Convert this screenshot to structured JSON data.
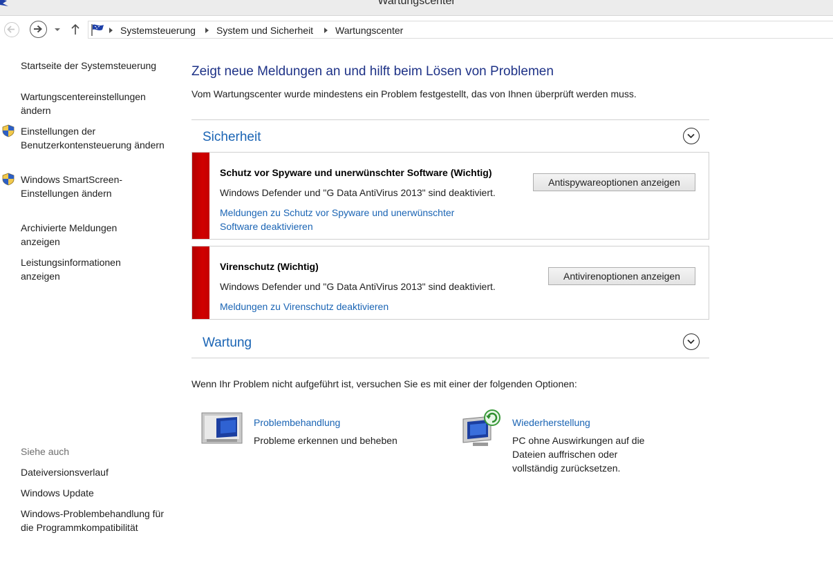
{
  "window": {
    "title": "Wartungscenter"
  },
  "breadcrumb": [
    "Systemsteuerung",
    "System und Sicherheit",
    "Wartungscenter"
  ],
  "sidebar": {
    "items": [
      {
        "label": "Startseite der Systemsteuerung",
        "shield": false
      },
      {
        "label": "Wartungscentereinstellungen ändern",
        "shield": false
      },
      {
        "label": "Einstellungen der Benutzerkontensteuerung ändern",
        "shield": true
      },
      {
        "label": "Windows SmartScreen-Einstellungen ändern",
        "shield": true
      },
      {
        "label": "Archivierte Meldungen anzeigen",
        "shield": false
      },
      {
        "label": "Leistungsinformationen anzeigen",
        "shield": false
      }
    ],
    "see_also_label": "Siehe auch",
    "see_also": [
      {
        "label": "Dateiversionsverlauf"
      },
      {
        "label": "Windows Update"
      },
      {
        "label": "Windows-Problembehandlung für die Programmkompatibilität"
      }
    ]
  },
  "main": {
    "heading": "Zeigt neue Meldungen an und hilft beim Lösen von Problemen",
    "subheading": "Vom Wartungscenter wurde mindestens ein Problem festgestellt, das von Ihnen überprüft werden muss.",
    "security": {
      "title": "Sicherheit",
      "messages": [
        {
          "title": "Schutz vor Spyware und unerwünschter Software  (Wichtig)",
          "text": "Windows Defender und \"G Data AntiVirus 2013\" sind deaktiviert.",
          "link": "Meldungen zu Schutz vor Spyware und unerwünschter Software deaktivieren",
          "button": "Antispywareoptionen anzeigen",
          "status_color": "#cc0000"
        },
        {
          "title": "Virenschutz  (Wichtig)",
          "text": "Windows Defender und \"G Data AntiVirus 2013\" sind deaktiviert.",
          "link": "Meldungen zu Virenschutz deaktivieren",
          "button": "Antivirenoptionen anzeigen",
          "status_color": "#cc0000"
        }
      ]
    },
    "maintenance": {
      "title": "Wartung"
    },
    "hint": "Wenn Ihr Problem nicht aufgeführt ist, versuchen Sie es mit einer der folgenden Optionen:",
    "options": [
      {
        "title": "Problembehandlung",
        "desc": "Probleme erkennen und beheben",
        "icon": "troubleshoot-icon"
      },
      {
        "title": "Wiederherstellung",
        "desc": "PC ohne Auswirkungen auf die Dateien auffrischen oder vollständig zurücksetzen.",
        "icon": "recovery-icon"
      }
    ]
  },
  "colors": {
    "link": "#1a64b4",
    "heading": "#1e3287",
    "critical": "#cc0000"
  }
}
